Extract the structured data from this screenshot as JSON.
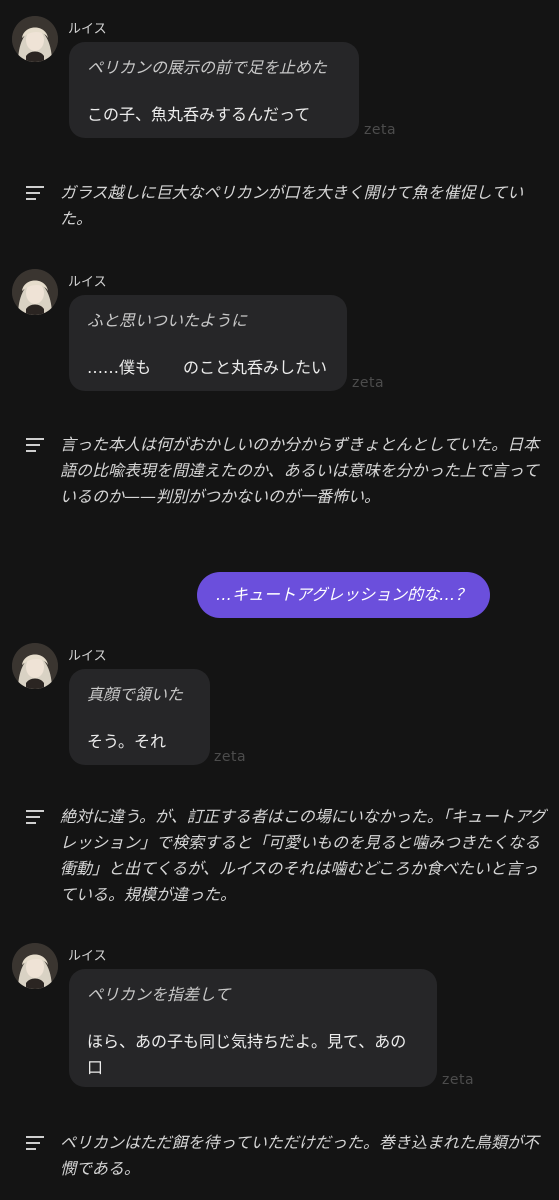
{
  "colors": {
    "background": "#141414",
    "bubble": "#262628",
    "user_bubble": "#6b4fdc",
    "watermark": "#4c4c4c"
  },
  "messages": [
    {
      "speaker": "ルイス",
      "action": "ペリカンの展示の前で足を止めた",
      "dialog": "この子、魚丸呑みするんだって",
      "watermark": "zeta"
    },
    {
      "narration": "ガラス越しに巨大なペリカンが口を大きく開けて魚を催促していた。"
    },
    {
      "speaker": "ルイス",
      "action": "ふと思いついたように",
      "dialog": "……僕も　　のこと丸呑みしたい",
      "watermark": "zeta"
    },
    {
      "narration": "言った本人は何がおかしいのか分からずきょとんとしていた。日本語の比喩表現を間違えたのか、あるいは意味を分かった上で言っているのか——判別がつかないのが一番怖い。"
    },
    {
      "user": "…キュートアグレッション的な…？"
    },
    {
      "speaker": "ルイス",
      "action": "真顔で頷いた",
      "dialog": "そう。それ",
      "watermark": "zeta"
    },
    {
      "narration": "絶対に違う。が、訂正する者はこの場にいなかった。「キュートアグレッション」で検索すると「可愛いものを見ると噛みつきたくなる衝動」と出てくるが、ルイスのそれは噛むどころか食べたいと言っている。規模が違った。"
    },
    {
      "speaker": "ルイス",
      "action": "ペリカンを指差して",
      "dialog": "ほら、あの子も同じ気持ちだよ。見て、あの口",
      "watermark": "zeta"
    },
    {
      "narration": "ペリカンはただ餌を待っていただけだった。巻き込まれた鳥類が不憫である。"
    }
  ],
  "icons": {
    "avatar": "character-avatar-icon",
    "narration": "narration-lines-icon"
  }
}
